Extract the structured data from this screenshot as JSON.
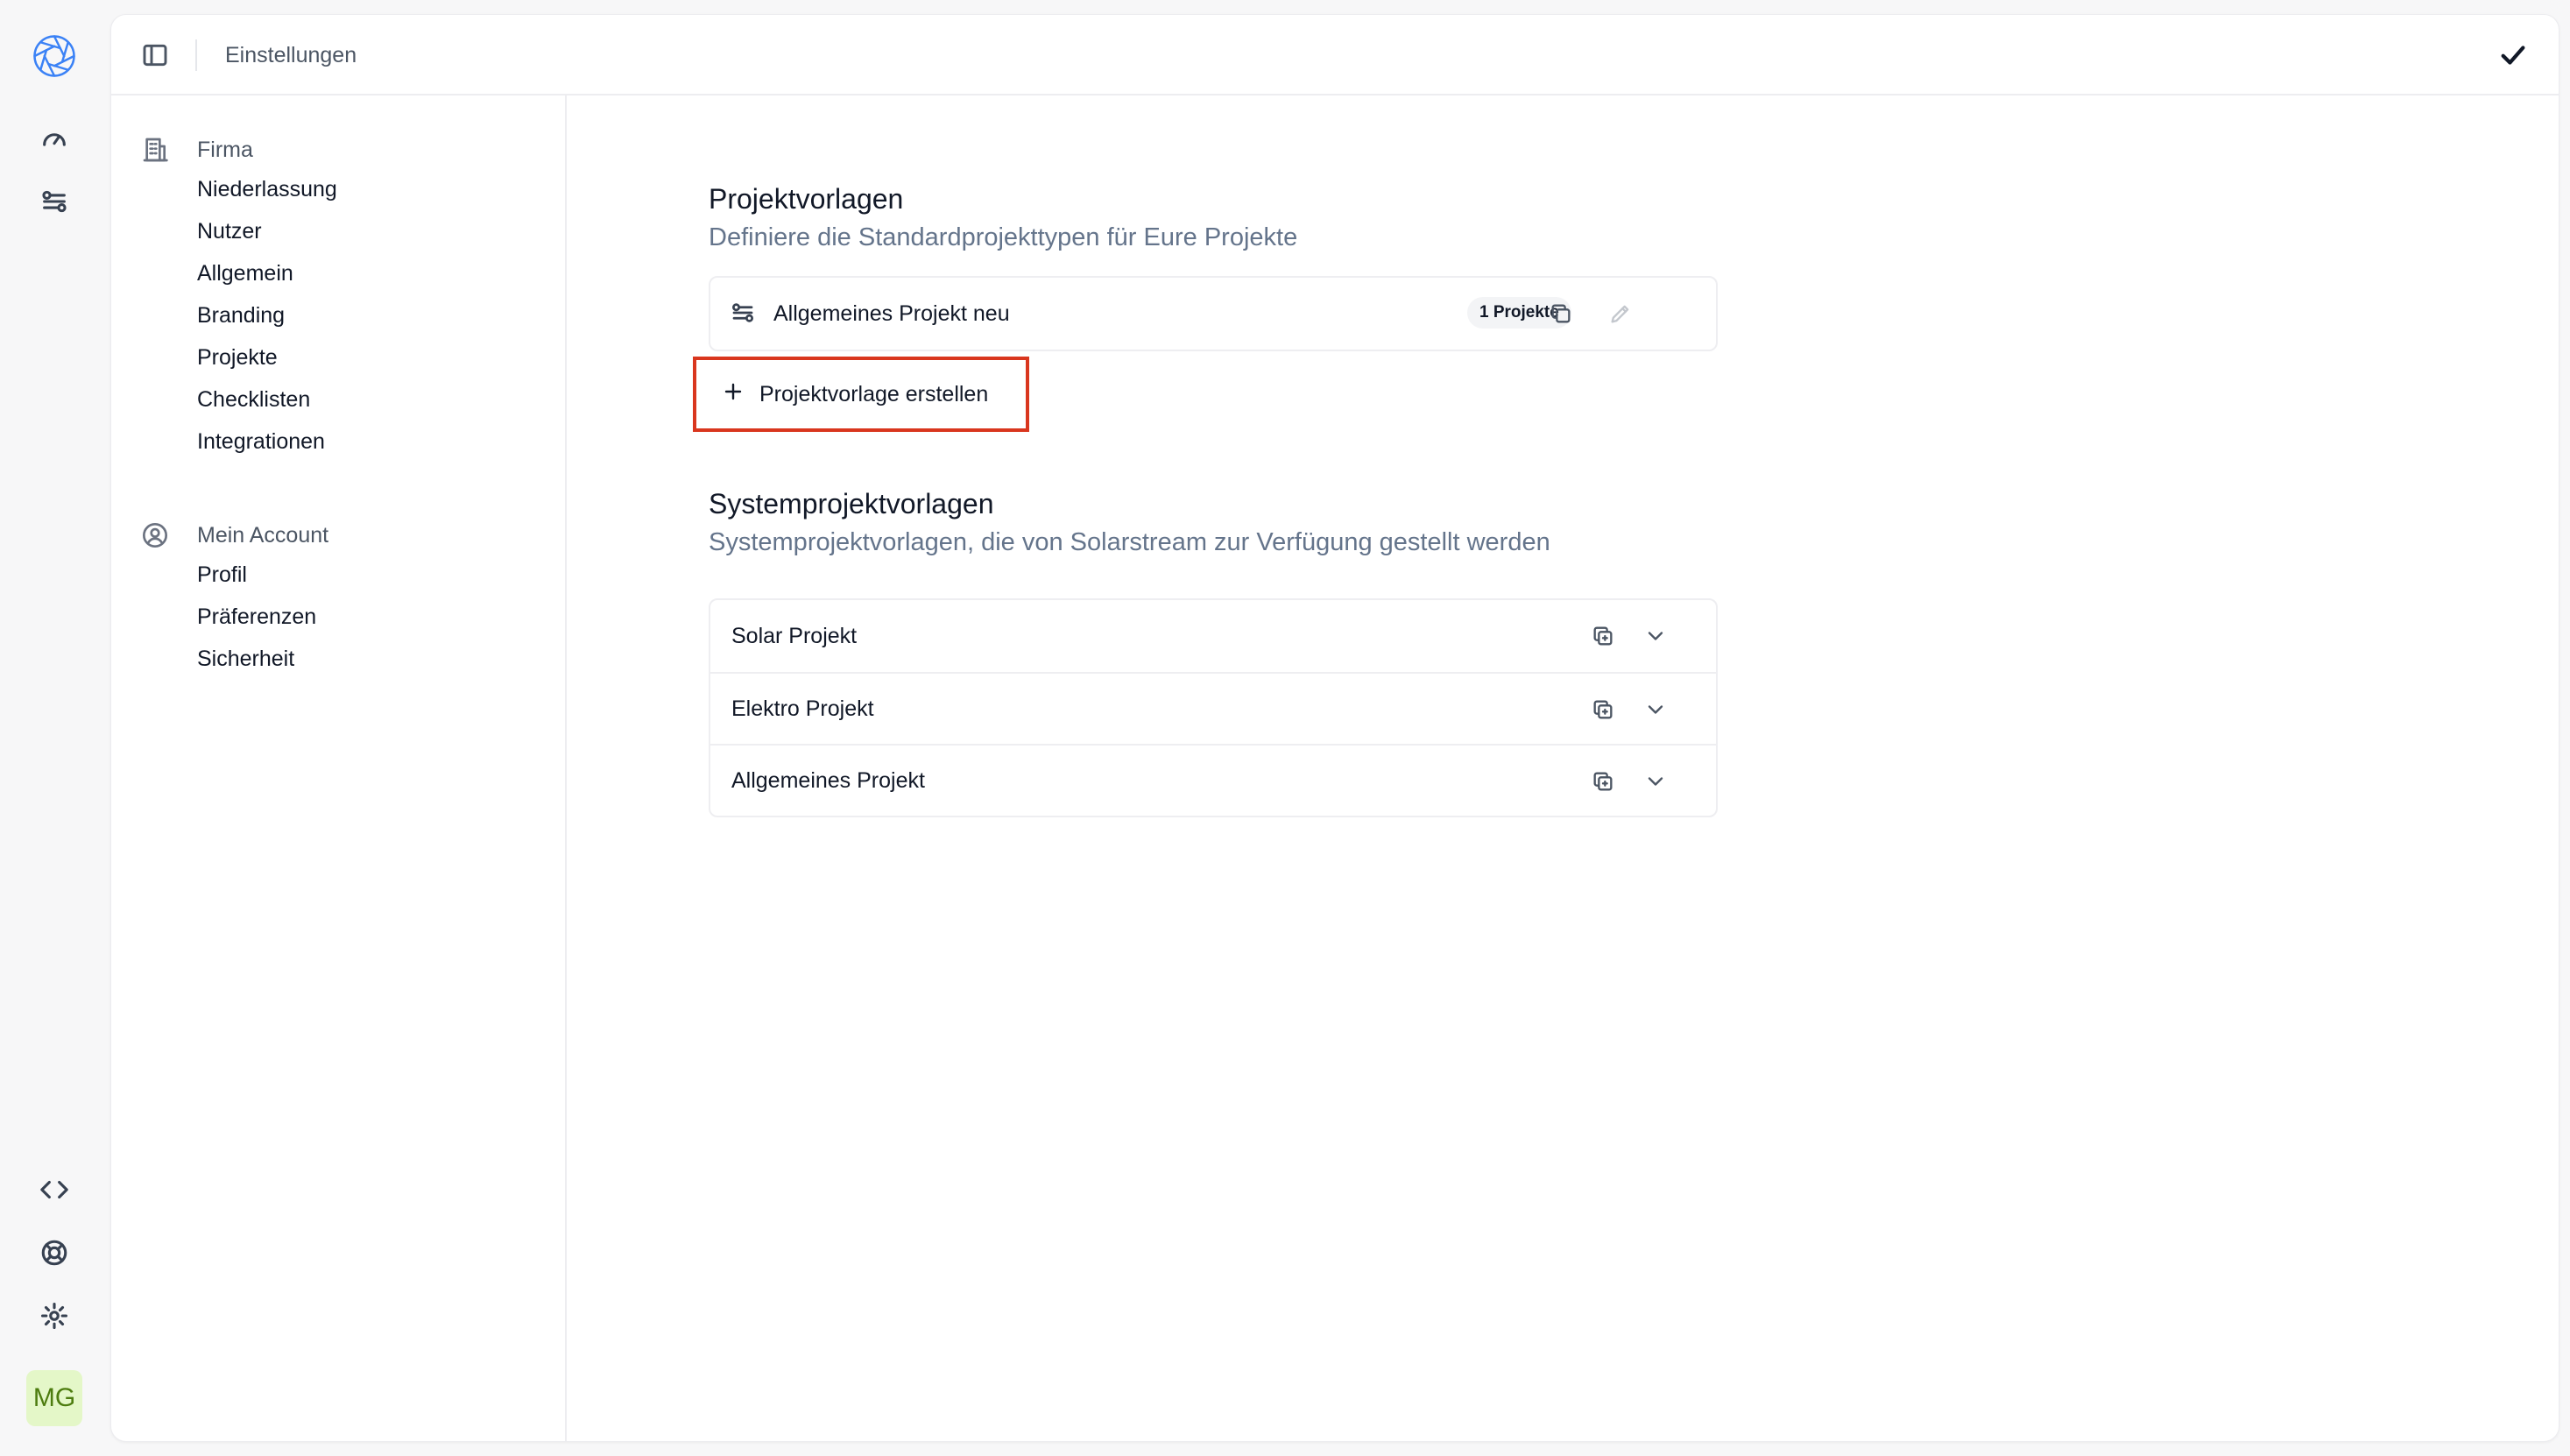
{
  "rail": {
    "logo": "solarstream-logo-icon",
    "top_icons": [
      "dashboard-icon",
      "templates-icon"
    ],
    "bottom_icons": [
      "code-icon",
      "help-icon",
      "settings-icon"
    ],
    "avatar_initials": "MG"
  },
  "topbar": {
    "breadcrumb": "Einstellungen"
  },
  "nav": {
    "firma": {
      "label": "Firma",
      "icon": "building-icon",
      "items": [
        "Niederlassung",
        "Nutzer",
        "Allgemein",
        "Branding",
        "Projekte",
        "Checklisten",
        "Integrationen"
      ]
    },
    "account": {
      "label": "Mein Account",
      "icon": "user-circle-icon",
      "items": [
        "Profil",
        "Präferenzen",
        "Sicherheit"
      ]
    }
  },
  "templates": {
    "title": "Projektvorlagen",
    "description": "Definiere die Standardprojekttypen für Eure Projekte",
    "items": [
      {
        "name": "Allgemeines Projekt neu",
        "badge": "1 Projekte"
      }
    ],
    "create_label": "Projektvorlage erstellen"
  },
  "system_templates": {
    "title": "Systemprojektvorlagen",
    "description": "Systemprojektvorlagen, die von Solarstream zur Verfügung gestellt werden",
    "items": [
      {
        "name": "Solar Projekt"
      },
      {
        "name": "Elektro Projekt"
      },
      {
        "name": "Allgemeines Projekt"
      }
    ]
  },
  "colors": {
    "highlight": "#d9361e",
    "avatar_bg": "#e4f7c8",
    "muted_text": "#64748b"
  }
}
